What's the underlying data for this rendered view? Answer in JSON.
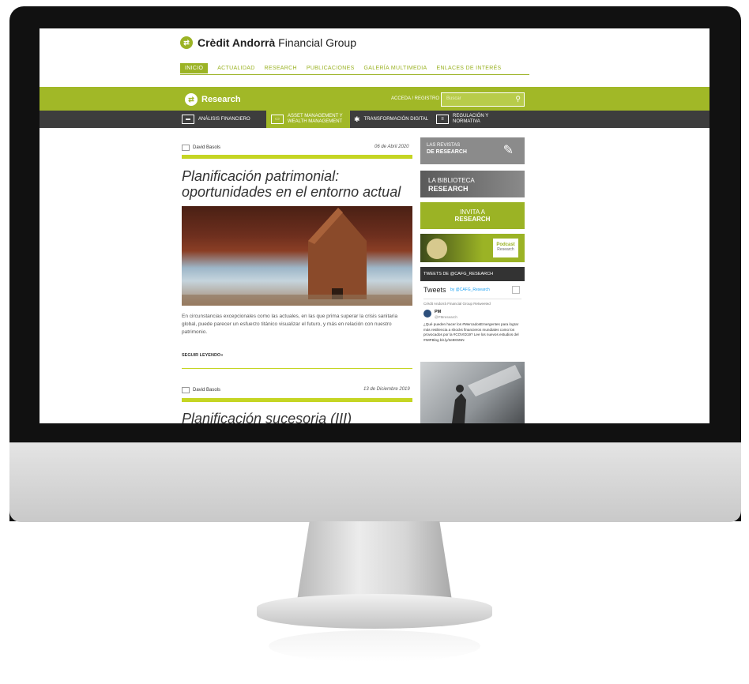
{
  "brand": {
    "name_bold": "Crèdit Andorrà",
    "name_rest": "Financial Group"
  },
  "topnav": [
    "INICIO",
    "ACTUALIDAD",
    "RESEARCH",
    "PUBLICACIONES",
    "GALERÍA MULTIMEDIA",
    "ENLACES DE INTERÉS"
  ],
  "section": {
    "title": "Research",
    "access": "ACCEDA / REGISTRO",
    "search_placeholder": "Buscar"
  },
  "categories": [
    {
      "label": "ANÁLISIS FINANCIERO"
    },
    {
      "label": "ASSET MANAGEMENT Y WEALTH MANAGEMENT"
    },
    {
      "label": "TRANSFORMACIÓN DIGITAL"
    },
    {
      "label": "REGULACIÓN Y NORMATIVA"
    }
  ],
  "articles": [
    {
      "author": "David Basols",
      "date": "06 de Abril 2020",
      "title": "Planificación patrimonial: oportunidades en el entorno actual",
      "excerpt": "En circunstancias excepcionales como las actuales, en las que prima superar la crisis sanitaria global, puede parecer un esfuerzo titánico visualizar el futuro, y más en relación con nuestro patrimonio.",
      "read_more": "SEGUIR LEYENDO»"
    },
    {
      "author": "David Basols",
      "date": "13 de Diciembre 2019",
      "title": "Planificación sucesoria (III)"
    }
  ],
  "sidebar": {
    "banners": [
      {
        "line1": "LAS REVISTAS",
        "line2": "DE RESEARCH"
      },
      {
        "line1": "LA BIBLIOTECA",
        "line2": "RESEARCH"
      },
      {
        "line1": "INVITA A",
        "line2": "RESEARCH"
      },
      {
        "line1": "Podcast",
        "line2": "Research"
      }
    ],
    "tweets_header": "TWEETS DE @CAFG_RESEARCH",
    "tweets_title": "Tweets",
    "tweets_by": "by @CAFG_Research",
    "tweet_retweet": "Crèdit Andorrà Financial Group Retweeted",
    "tweet_author": "PM",
    "tweet_handle": "@PMresearch",
    "tweet_text": "¿Qué pueden hacer los #MercadosEmergentes para lograr más resiliencia a shocks financieros mundiales como los provocados por la #COVID19? Lee los nuevos estudios del #IMFBlog bit.ly/3e9K5NN"
  }
}
